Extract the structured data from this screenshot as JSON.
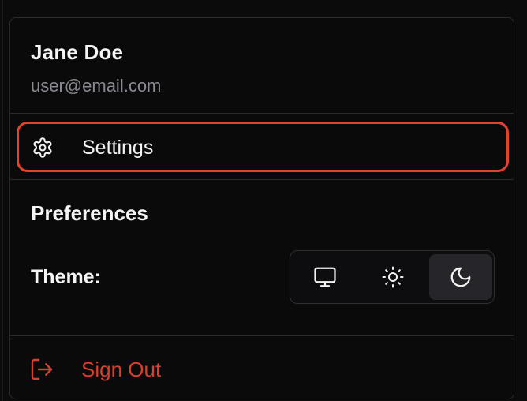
{
  "user": {
    "name": "Jane Doe",
    "email": "user@email.com"
  },
  "menu": {
    "settings": {
      "label": "Settings",
      "icon": "gear-icon",
      "highlight_color": "#e0442a"
    },
    "preferences": {
      "title": "Preferences",
      "theme": {
        "label": "Theme:",
        "options": [
          {
            "id": "system",
            "icon": "monitor-icon",
            "selected": false
          },
          {
            "id": "light",
            "icon": "sun-icon",
            "selected": false
          },
          {
            "id": "dark",
            "icon": "moon-icon",
            "selected": true
          }
        ]
      }
    },
    "sign_out": {
      "label": "Sign Out",
      "icon": "sign-out-icon",
      "color": "#d6402d"
    }
  },
  "colors": {
    "background": "#0a0a0b",
    "border": "#2a2a2e",
    "text": "#f5f5f5",
    "muted_text": "#8a8a92",
    "selected_option_bg": "#26262a"
  }
}
